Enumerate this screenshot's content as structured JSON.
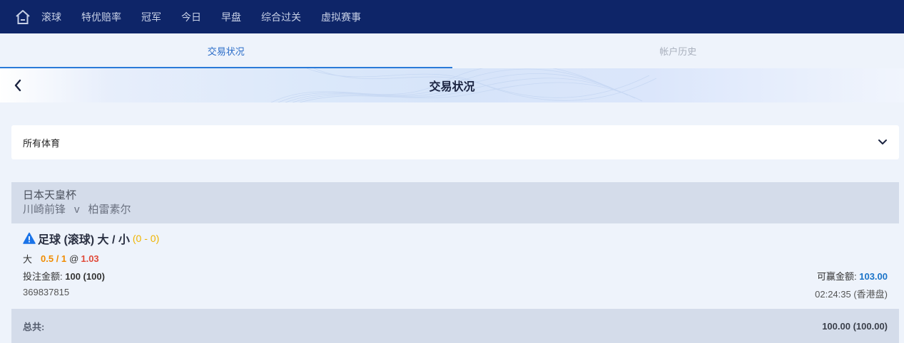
{
  "nav": {
    "home_icon": "home-icon",
    "items": [
      "滚球",
      "特优赔率",
      "冠军",
      "今日",
      "早盘",
      "综合过关",
      "虚拟赛事"
    ]
  },
  "tabs": [
    {
      "label": "交易状况",
      "active": true
    },
    {
      "label": "帐户历史",
      "active": false
    }
  ],
  "header": {
    "back_icon": "chevron-left-icon",
    "title": "交易状况"
  },
  "filter": {
    "selected": "所有体育",
    "icon": "chevron-down-icon"
  },
  "bet": {
    "league": "日本天皇杯",
    "home_team": "川崎前锋",
    "vs": "v",
    "away_team": "柏雷素尔",
    "warning_icon": "warning-icon",
    "market": "足球 (滚球) 大 / 小",
    "score": "(0 - 0)",
    "selection": "大",
    "handicap": "0.5 / 1",
    "at": "@",
    "odds": "1.03",
    "stake_label": "投注金额:",
    "stake_value": "100 (100)",
    "win_label": "可赢金额:",
    "win_value": "103.00",
    "ticket_id": "369837815",
    "time": "02:24:35 (香港盘)"
  },
  "total": {
    "label": "总共:",
    "value": "100.00 (100.00)"
  },
  "colors": {
    "nav_bg": "#0e2568",
    "active_tab": "#2a6cc8",
    "handicap": "#f08c00",
    "odds": "#e04a3a",
    "win": "#1a73c8",
    "score": "#f0b400",
    "warning": "#1a73e8"
  }
}
